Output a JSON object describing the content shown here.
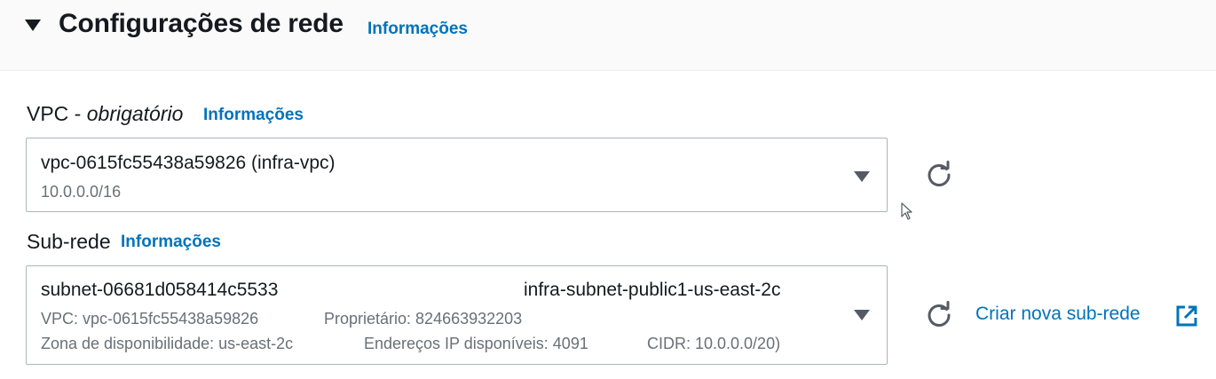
{
  "header": {
    "title": "Configurações de rede",
    "info_link": "Informações"
  },
  "vpc": {
    "label": "VPC - ",
    "label_required": "obrigatório",
    "info_link": "Informações",
    "selected": {
      "id": "vpc-0615fc55438a59826 (infra-vpc)",
      "cidr": "10.0.0.0/16"
    }
  },
  "subnet": {
    "label": "Sub-rede",
    "info_link": "Informações",
    "selected": {
      "id": "subnet-06681d058414c5533",
      "name": "infra-subnet-public1-us-east-2c",
      "vpc": "VPC: vpc-0615fc55438a59826",
      "owner": "Proprietário: 824663932203",
      "zone": "Zona de disponibilidade: us-east-2c",
      "ips": "Endereços IP disponíveis: 4091",
      "cidr": "CIDR: 10.0.0.0/20)"
    },
    "create_link": "Criar nova sub-rede"
  },
  "icons": {
    "section_toggle": "caret-down-icon",
    "refresh": "refresh-icon",
    "external": "external-link-icon",
    "dropdown": "caret-down-icon",
    "pointer": "mouse-cursor-icon"
  },
  "colors": {
    "link": "#0073bb",
    "text": "#16191f",
    "secondary_text": "#687078",
    "border": "#aab7b8",
    "header_bg": "#fafafa"
  }
}
